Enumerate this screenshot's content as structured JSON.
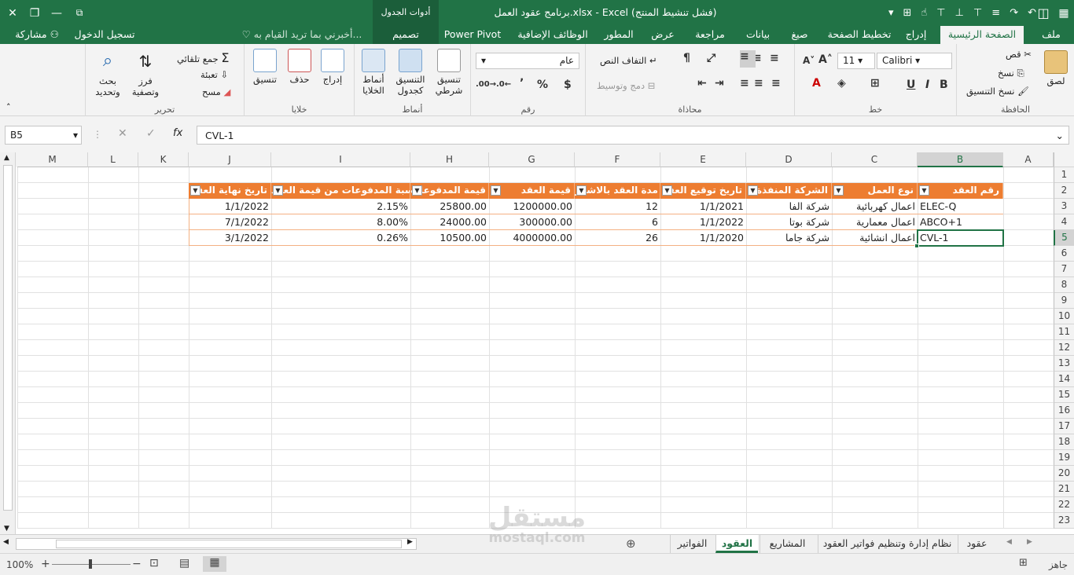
{
  "title_bar": {
    "title": "برنامج عقود العمل.xlsx - Excel (فشل تنشيط المنتج)",
    "context_tools": "أدوات الجدول",
    "close_glyph": "✕",
    "restore_glyph": "❐",
    "minimize_glyph": "—",
    "options_glyph": "⧉"
  },
  "tabs": {
    "file": "ملف",
    "home": "الصفحة الرئيسية",
    "insert": "إدراج",
    "page_layout": "تخطيط الصفحة",
    "formulas": "صيغ",
    "data": "بيانات",
    "review": "مراجعة",
    "view": "عرض",
    "developer": "المطور",
    "addins": "الوظائف الإضافية",
    "powerpivot": "Power Pivot",
    "design": "تصميم",
    "tell_me": "أخبرني بما تريد القيام به...",
    "sign_in": "تسجيل الدخول",
    "share": "مشاركة"
  },
  "ribbon": {
    "clipboard": {
      "label": "الحافظة",
      "paste": "لصق",
      "cut": "قص",
      "copy": "نسخ",
      "format_painter": "نسخ التنسيق"
    },
    "font": {
      "label": "خط",
      "name": "Calibri",
      "size": "11",
      "bold": "B",
      "italic": "I",
      "underline": "U"
    },
    "alignment": {
      "label": "محاذاة",
      "wrap": "التفاف النص",
      "merge": "دمج وتوسيط"
    },
    "number": {
      "label": "رقم",
      "format": "عام",
      "currency": "$",
      "percent": "%",
      "comma": "٬"
    },
    "styles": {
      "label": "أنماط",
      "conditional": "تنسيق شرطي",
      "as_table": "التنسيق كجدول",
      "cell_styles": "أنماط الخلايا"
    },
    "cells": {
      "label": "خلايا",
      "insert": "إدراج",
      "delete": "حذف",
      "format": "تنسيق"
    },
    "editing": {
      "label": "تحرير",
      "autosum": "جمع تلقائي",
      "fill": "تعبئة",
      "clear": "مسح",
      "sort": "فرز وتصفية",
      "find": "بحث وتحديد"
    }
  },
  "formula_bar": {
    "name_box": "B5",
    "fx": "fx",
    "content": "CVL-1"
  },
  "columns": [
    "A",
    "B",
    "C",
    "D",
    "E",
    "F",
    "G",
    "H",
    "I",
    "J",
    "K",
    "L",
    "M"
  ],
  "rows": [
    "1",
    "2",
    "3",
    "4",
    "5",
    "6",
    "7",
    "8",
    "9",
    "10",
    "11",
    "12",
    "13",
    "14",
    "15",
    "16",
    "17",
    "18",
    "19",
    "20",
    "21",
    "22",
    "23"
  ],
  "table": {
    "headers": [
      "رقم العقد",
      "نوع العمل",
      "الشركة المنفذة",
      "تاريخ توقيع العقد",
      "مدة العقد بالاشهر",
      "قيمة العقد",
      "قيمة المدفوعات",
      "نسبة المدفوعات من قيمة العقد",
      "تاريخ نهاية العقد"
    ],
    "rows": [
      [
        "ELEC-Q",
        "اعمال كهربائية",
        "شركة الفا",
        "1/1/2021",
        "12",
        "1200000.00",
        "25800.00",
        "2.15%",
        "1/1/2022"
      ],
      [
        "ABCO+1",
        "اعمال معمارية",
        "شركة بوتا",
        "1/1/2022",
        "6",
        "300000.00",
        "24000.00",
        "8.00%",
        "7/1/2022"
      ],
      [
        "CVL-1",
        "اعمال انشائية",
        "شركة جاما",
        "1/1/2020",
        "26",
        "4000000.00",
        "10500.00",
        "0.26%",
        "3/1/2022"
      ]
    ]
  },
  "sheets": [
    "عقود",
    "نظام إدارة وتنظيم فواتير العقود",
    "المشاريع",
    "العقود",
    "الفواتير"
  ],
  "active_sheet": "العقود",
  "status": {
    "ready": "جاهز",
    "zoom": "100%"
  },
  "watermark": {
    "arabic": "مستقل",
    "latin": "mostaql.com"
  }
}
